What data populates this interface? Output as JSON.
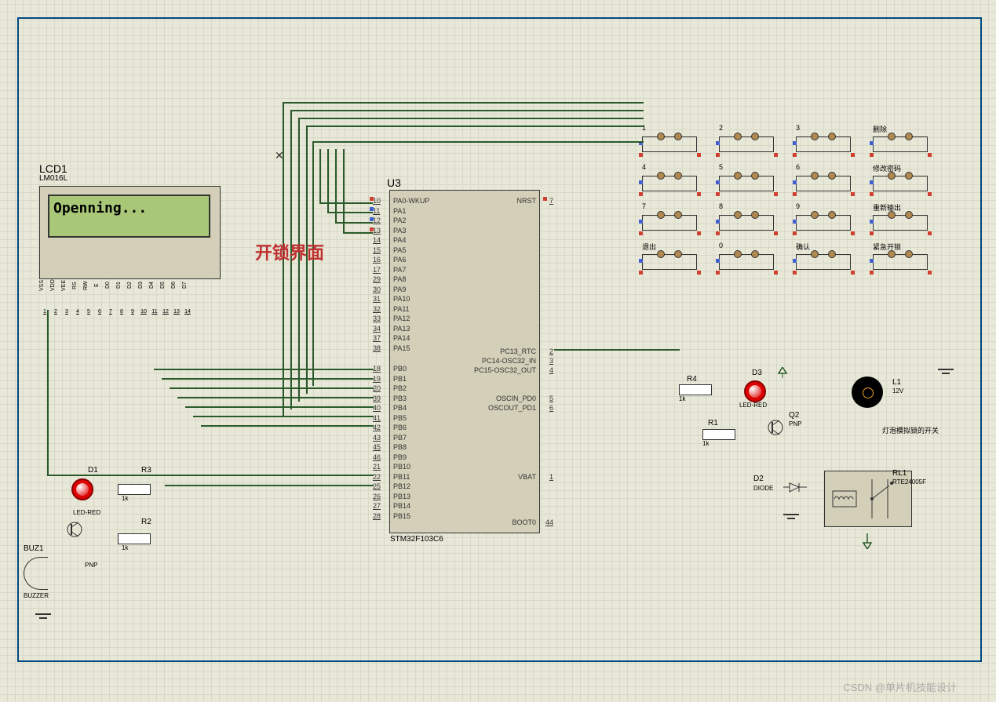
{
  "lcd": {
    "ref": "LCD1",
    "part": "LM016L",
    "text": "Openning...",
    "pins": [
      "VSS",
      "VDD",
      "VEE",
      "RS",
      "RW",
      "E",
      "D0",
      "D1",
      "D2",
      "D3",
      "D4",
      "D5",
      "D6",
      "D7"
    ],
    "pinNums": [
      "1",
      "2",
      "3",
      "4",
      "5",
      "6",
      "7",
      "8",
      "9",
      "10",
      "11",
      "12",
      "13",
      "14"
    ]
  },
  "annotation": "开锁界面",
  "mcu": {
    "ref": "U3",
    "part": "STM32F103C6",
    "nrst": "NRST",
    "nrst_num": "7",
    "pa": [
      {
        "n": "10",
        "l": "PA0-WKUP"
      },
      {
        "n": "11",
        "l": "PA1"
      },
      {
        "n": "12",
        "l": "PA2"
      },
      {
        "n": "13",
        "l": "PA3"
      },
      {
        "n": "14",
        "l": "PA4"
      },
      {
        "n": "15",
        "l": "PA5"
      },
      {
        "n": "16",
        "l": "PA6"
      },
      {
        "n": "17",
        "l": "PA7"
      },
      {
        "n": "29",
        "l": "PA8"
      },
      {
        "n": "30",
        "l": "PA9"
      },
      {
        "n": "31",
        "l": "PA10"
      },
      {
        "n": "32",
        "l": "PA11"
      },
      {
        "n": "33",
        "l": "PA12"
      },
      {
        "n": "34",
        "l": "PA13"
      },
      {
        "n": "37",
        "l": "PA14"
      },
      {
        "n": "38",
        "l": "PA15"
      }
    ],
    "pb": [
      {
        "n": "18",
        "l": "PB0"
      },
      {
        "n": "19",
        "l": "PB1"
      },
      {
        "n": "20",
        "l": "PB2"
      },
      {
        "n": "39",
        "l": "PB3"
      },
      {
        "n": "40",
        "l": "PB4"
      },
      {
        "n": "41",
        "l": "PB5"
      },
      {
        "n": "42",
        "l": "PB6"
      },
      {
        "n": "43",
        "l": "PB7"
      },
      {
        "n": "45",
        "l": "PB8"
      },
      {
        "n": "46",
        "l": "PB9"
      },
      {
        "n": "21",
        "l": "PB10"
      },
      {
        "n": "22",
        "l": "PB11"
      },
      {
        "n": "25",
        "l": "PB12"
      },
      {
        "n": "26",
        "l": "PB13"
      },
      {
        "n": "27",
        "l": "PB14"
      },
      {
        "n": "28",
        "l": "PB15"
      }
    ],
    "pc": [
      {
        "n": "2",
        "l": "PC13_RTC"
      },
      {
        "n": "3",
        "l": "PC14-OSC32_IN"
      },
      {
        "n": "4",
        "l": "PC15-OSC32_OUT"
      }
    ],
    "osc": [
      {
        "n": "5",
        "l": "OSCIN_PD0"
      },
      {
        "n": "6",
        "l": "OSCOUT_PD1"
      }
    ],
    "vbat": {
      "n": "1",
      "l": "VBAT"
    },
    "boot": {
      "n": "44",
      "l": "BOOT0"
    }
  },
  "keypad": {
    "keys": [
      {
        "r": 0,
        "c": 0,
        "l": "1"
      },
      {
        "r": 0,
        "c": 1,
        "l": "2"
      },
      {
        "r": 0,
        "c": 2,
        "l": "3"
      },
      {
        "r": 0,
        "c": 3,
        "l": "删除"
      },
      {
        "r": 1,
        "c": 0,
        "l": "4"
      },
      {
        "r": 1,
        "c": 1,
        "l": "5"
      },
      {
        "r": 1,
        "c": 2,
        "l": "6"
      },
      {
        "r": 1,
        "c": 3,
        "l": "修改密码"
      },
      {
        "r": 2,
        "c": 0,
        "l": "7"
      },
      {
        "r": 2,
        "c": 1,
        "l": "8"
      },
      {
        "r": 2,
        "c": 2,
        "l": "9"
      },
      {
        "r": 2,
        "c": 3,
        "l": "重新输出"
      },
      {
        "r": 3,
        "c": 0,
        "l": "退出"
      },
      {
        "r": 3,
        "c": 1,
        "l": "0"
      },
      {
        "r": 3,
        "c": 2,
        "l": "确认"
      },
      {
        "r": 3,
        "c": 3,
        "l": "紧急开锁"
      }
    ]
  },
  "left": {
    "d1": {
      "ref": "D1",
      "part": "LED-RED"
    },
    "r2": {
      "ref": "R2",
      "val": "1k"
    },
    "r3": {
      "ref": "R3",
      "val": "1k"
    },
    "buz": {
      "ref": "BUZ1",
      "part": "BUZZER"
    },
    "q_part": "PNP"
  },
  "right": {
    "r1": {
      "ref": "R1",
      "val": "1k"
    },
    "r4": {
      "ref": "R4",
      "val": "1k"
    },
    "d3": {
      "ref": "D3",
      "part": "LED-RED"
    },
    "q2": {
      "ref": "Q2",
      "part": "PNP"
    },
    "d2": {
      "ref": "D2",
      "part": "DIODE"
    },
    "rl1": {
      "ref": "RL1",
      "part": "RTE24005F"
    },
    "l1": {
      "ref": "L1",
      "val": "12V"
    },
    "lamp_note": "灯泡模拟锁的开关"
  },
  "watermark": "CSDN @单片机技能设计",
  "cross": "✕"
}
